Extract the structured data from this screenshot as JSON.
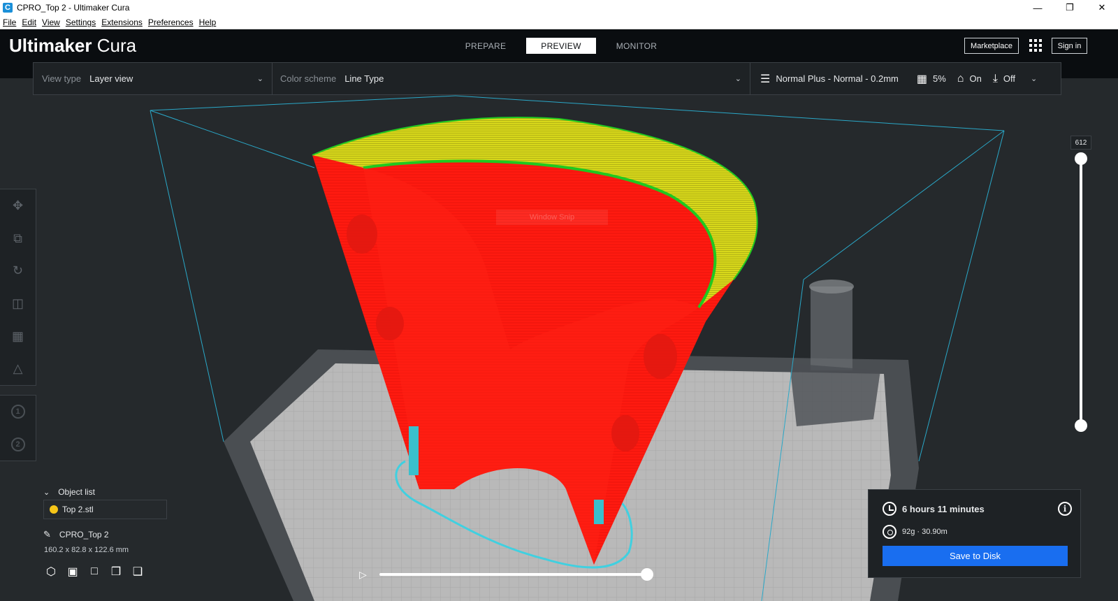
{
  "window": {
    "title": "CPRO_Top 2 - Ultimaker Cura",
    "app_icon": "C",
    "minimize": "—",
    "maximize": "❐",
    "close": "✕"
  },
  "menubar": [
    "File",
    "Edit",
    "View",
    "Settings",
    "Extensions",
    "Preferences",
    "Help"
  ],
  "header": {
    "brand_bold": "Ultimaker",
    "brand_light": "Cura",
    "stages": [
      "PREPARE",
      "PREVIEW",
      "MONITOR"
    ],
    "active_stage": "PREVIEW",
    "marketplace": "Marketplace",
    "sign_in": "Sign in"
  },
  "settings_bar": {
    "view_type_label": "View type",
    "view_type_value": "Layer view",
    "color_scheme_label": "Color scheme",
    "color_scheme_value": "Line Type",
    "profile": "Normal Plus - Normal - 0.2mm",
    "infill": "5%",
    "support": "On",
    "adhesion": "Off"
  },
  "layer_slider": {
    "current_layer": "612"
  },
  "object_list": {
    "header": "Object list",
    "items": [
      "Top 2.stl"
    ],
    "project_name": "CPRO_Top 2",
    "dimensions": "160.2 x 82.8 x 122.6 mm"
  },
  "print_info": {
    "time": "6 hours 11 minutes",
    "material": "92g · 30.90m",
    "save_label": "Save to Disk"
  },
  "overlay": {
    "snip_text": "Window Snip"
  },
  "playback": {
    "progress": 1.0
  },
  "colors": {
    "accent": "#196ef0",
    "wall_red": "#ff1a10",
    "top_yellow": "#d8d81a",
    "skin_green": "#20c820",
    "support_cyan": "#40c8d8",
    "build_volume": "#2aa8c8"
  }
}
